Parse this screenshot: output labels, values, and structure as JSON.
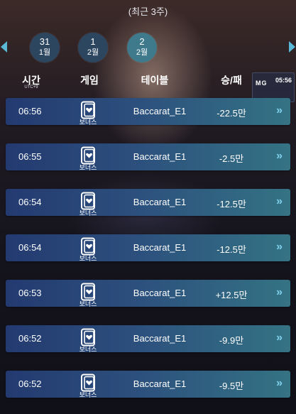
{
  "subtitle": "(최근 3주)",
  "dates": [
    {
      "day": "31",
      "month": "1월",
      "active": false
    },
    {
      "day": "1",
      "month": "2월",
      "active": false
    },
    {
      "day": "2",
      "month": "2월",
      "active": true
    }
  ],
  "header": {
    "time": "시간",
    "timezone": "UTC+9",
    "game": "게임",
    "table": "테이블",
    "result": "승/패"
  },
  "background_panel": {
    "logo": "MG",
    "time": "05:56"
  },
  "rows": [
    {
      "time": "06:56",
      "game": "보너스",
      "table": "Baccarat_E1",
      "result": "-22.5만"
    },
    {
      "time": "06:55",
      "game": "보너스",
      "table": "Baccarat_E1",
      "result": "-2.5만"
    },
    {
      "time": "06:54",
      "game": "보너스",
      "table": "Baccarat_E1",
      "result": "-12.5만"
    },
    {
      "time": "06:54",
      "game": "보너스",
      "table": "Baccarat_E1",
      "result": "-12.5만"
    },
    {
      "time": "06:53",
      "game": "보너스",
      "table": "Baccarat_E1",
      "result": "+12.5만"
    },
    {
      "time": "06:52",
      "game": "보너스",
      "table": "Baccarat_E1",
      "result": "-9.9만"
    },
    {
      "time": "06:52",
      "game": "보너스",
      "table": "Baccarat_E1",
      "result": "-9.5만"
    }
  ],
  "icons": {
    "prev": "chevron-left-icon",
    "next": "chevron-right-icon",
    "game": "bonus-card-icon",
    "row_action": "double-chevron-right-icon"
  },
  "row_arrow_glyph": "»",
  "colors": {
    "accent": "#5ab8d6",
    "row_gradient_start": "#233a70",
    "row_gradient_end": "#347384",
    "date_active": "#3f7a8c",
    "date_inactive": "#2c4660"
  }
}
